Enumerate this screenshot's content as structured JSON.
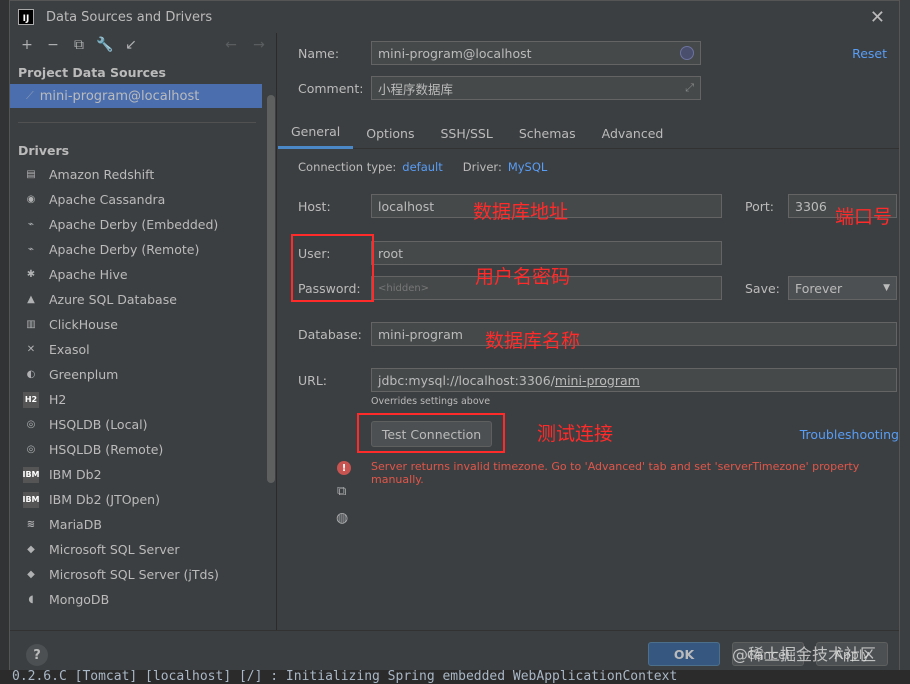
{
  "window": {
    "title": "Data Sources and Drivers",
    "app_icon": "IJ"
  },
  "left_panel": {
    "project_title": "Project Data Sources",
    "selected_source": "mini-program@localhost",
    "drivers_title": "Drivers",
    "drivers": [
      {
        "label": "Amazon Redshift",
        "icon": "redshift-icon"
      },
      {
        "label": "Apache Cassandra",
        "icon": "cassandra-icon"
      },
      {
        "label": "Apache Derby (Embedded)",
        "icon": "derby-icon"
      },
      {
        "label": "Apache Derby (Remote)",
        "icon": "derby-icon"
      },
      {
        "label": "Apache Hive",
        "icon": "hive-icon"
      },
      {
        "label": "Azure SQL Database",
        "icon": "azure-icon"
      },
      {
        "label": "ClickHouse",
        "icon": "clickhouse-icon"
      },
      {
        "label": "Exasol",
        "icon": "exasol-icon"
      },
      {
        "label": "Greenplum",
        "icon": "greenplum-icon"
      },
      {
        "label": "H2",
        "icon": "h2-icon"
      },
      {
        "label": "HSQLDB (Local)",
        "icon": "hsqldb-icon"
      },
      {
        "label": "HSQLDB (Remote)",
        "icon": "hsqldb-icon"
      },
      {
        "label": "IBM Db2",
        "icon": "ibm-icon"
      },
      {
        "label": "IBM Db2 (JTOpen)",
        "icon": "ibm-icon"
      },
      {
        "label": "MariaDB",
        "icon": "mariadb-icon"
      },
      {
        "label": "Microsoft SQL Server",
        "icon": "mssql-icon"
      },
      {
        "label": "Microsoft SQL Server (jTds)",
        "icon": "mssql-icon"
      },
      {
        "label": "MongoDB",
        "icon": "mongodb-icon"
      }
    ]
  },
  "form": {
    "name_label": "Name:",
    "name_value": "mini-program@localhost",
    "comment_label": "Comment:",
    "comment_value": "小程序数据库",
    "reset": "Reset",
    "tabs": [
      "General",
      "Options",
      "SSH/SSL",
      "Schemas",
      "Advanced"
    ],
    "conn_type_label": "Connection type:",
    "conn_type_value": "default",
    "driver_label": "Driver:",
    "driver_value": "MySQL",
    "host_label": "Host:",
    "host_value": "localhost",
    "port_label": "Port:",
    "port_value": "3306",
    "user_label": "User:",
    "user_value": "root",
    "password_label": "Password:",
    "password_value": "<hidden>",
    "save_label": "Save:",
    "save_value": "Forever",
    "database_label": "Database:",
    "database_value": "mini-program",
    "url_label": "URL:",
    "url_prefix": "jdbc:mysql://localhost:3306/",
    "url_db": "mini-program",
    "url_hint": "Overrides settings above",
    "test_button": "Test Connection",
    "troubleshooting": "Troubleshooting",
    "error": "Server returns invalid timezone. Go to 'Advanced' tab and set 'serverTimezone' property manually."
  },
  "annotations": {
    "host": "数据库地址",
    "port": "端口号",
    "user": "用户名密码",
    "database": "数据库名称",
    "test": "测试连接"
  },
  "footer": {
    "ok": "OK",
    "cancel": "Cancel",
    "apply": "Apply",
    "help": "?",
    "watermark": "@稀土掘金技术社区"
  },
  "background": {
    "code_line": "0.2.6.C [Tomcat] [localhost] [/]         : Initializing Spring embedded WebApplicationContext"
  },
  "colors": {
    "accent": "#4b6eaf",
    "link": "#589df6",
    "annotation": "#ff2a2a",
    "error": "#e0564a"
  }
}
